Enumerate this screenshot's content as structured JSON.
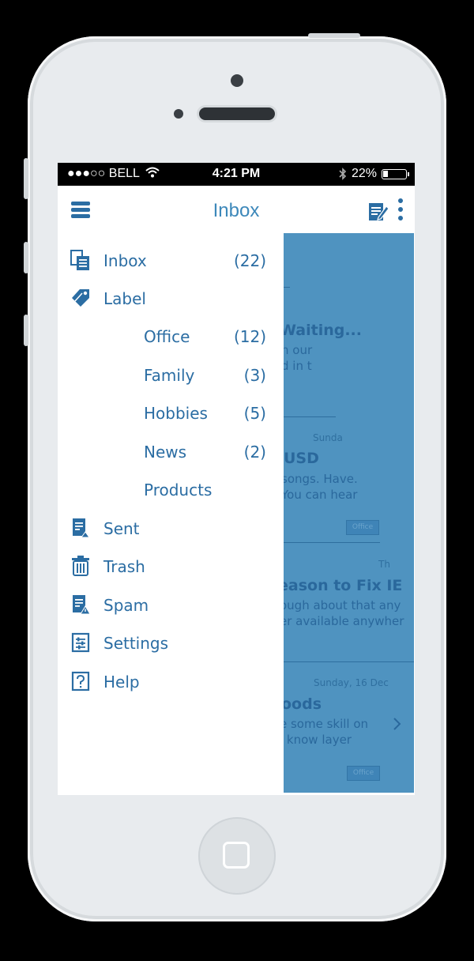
{
  "status_bar": {
    "carrier": "●●●○○ BELL",
    "time": "4:21 PM",
    "battery": "22%",
    "battery_level": 0.22
  },
  "header": {
    "title": "Inbox",
    "menu_icon": "hamburger-icon",
    "compose_icon": "compose-icon",
    "more_icon": "kebab-icon"
  },
  "drawer": {
    "items": [
      {
        "label": "Inbox",
        "count": "(22)",
        "icon": "inbox-icon"
      },
      {
        "label": "Label",
        "count": "",
        "icon": "tag-icon"
      },
      {
        "label": "Office",
        "count": "(12)"
      },
      {
        "label": "Family",
        "count": "(3)"
      },
      {
        "label": "Hobbies",
        "count": "(5)"
      },
      {
        "label": "News",
        "count": "(2)"
      },
      {
        "label": "Products",
        "count": ""
      },
      {
        "label": "Sent",
        "count": "",
        "icon": "sent-icon"
      },
      {
        "label": "Trash",
        "count": "",
        "icon": "trash-icon"
      },
      {
        "label": "Spam",
        "count": "",
        "icon": "spam-icon"
      },
      {
        "label": "Settings",
        "count": "",
        "icon": "settings-icon"
      },
      {
        "label": "Help",
        "count": "",
        "icon": "help-icon"
      }
    ]
  },
  "peek": {
    "m1_subject": "Waiting...",
    "m1_line1": "n our",
    "m1_line2": "d in t",
    "m2_date": "Sunda",
    "m2_subject": "USD",
    "m2_line1": "songs. Have.",
    "m2_line2": "You can hear",
    "m2_badge": "Office",
    "m3_date": "Th",
    "m3_subject": "eason to Fix IE",
    "m3_line1": "ough about that any",
    "m3_line2": "er available anywher",
    "m4_date": "Sunday, 16 Dec",
    "m4_subject": "oods",
    "m4_line1": "e some skill on",
    "m4_line2": "l know layer",
    "m4_badge": "Office"
  },
  "colors": {
    "accent": "#2b6da3",
    "title": "#3d88ba",
    "peek_bg": "#4f93c0",
    "phone_body": "#e8ebee"
  }
}
